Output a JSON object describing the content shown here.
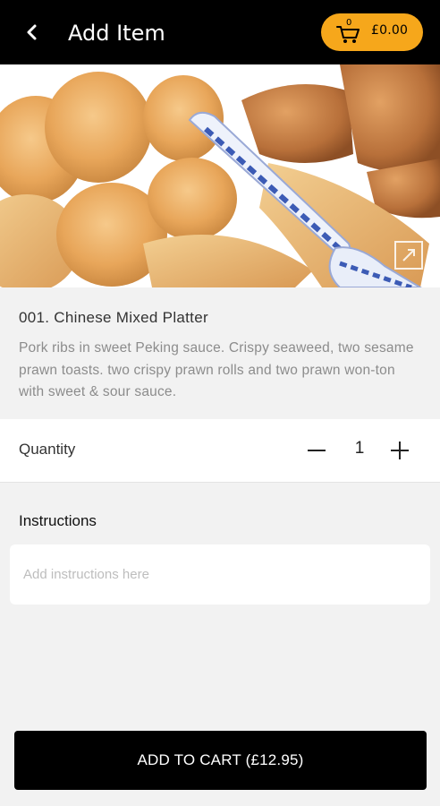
{
  "header": {
    "back_icon": "chevron-left-icon",
    "title": "Add Item",
    "cart": {
      "icon": "shopping-cart-icon",
      "count": "0",
      "total": "£0.00",
      "color": "#f6a71b"
    }
  },
  "hero": {
    "expand_icon": "expand-icon"
  },
  "item": {
    "name": "001. Chinese Mixed Platter",
    "description": "Pork ribs in sweet Peking sauce. Crispy seaweed, two sesame prawn toasts. two crispy prawn rolls and two prawn won-ton with sweet & sour sauce."
  },
  "quantity": {
    "label": "Quantity",
    "value": "1",
    "minus_icon": "minus-icon",
    "plus_icon": "plus-icon"
  },
  "instructions": {
    "label": "Instructions",
    "placeholder": "Add instructions here",
    "value": ""
  },
  "add_to_cart": {
    "label": "ADD TO CART (£12.95)"
  }
}
